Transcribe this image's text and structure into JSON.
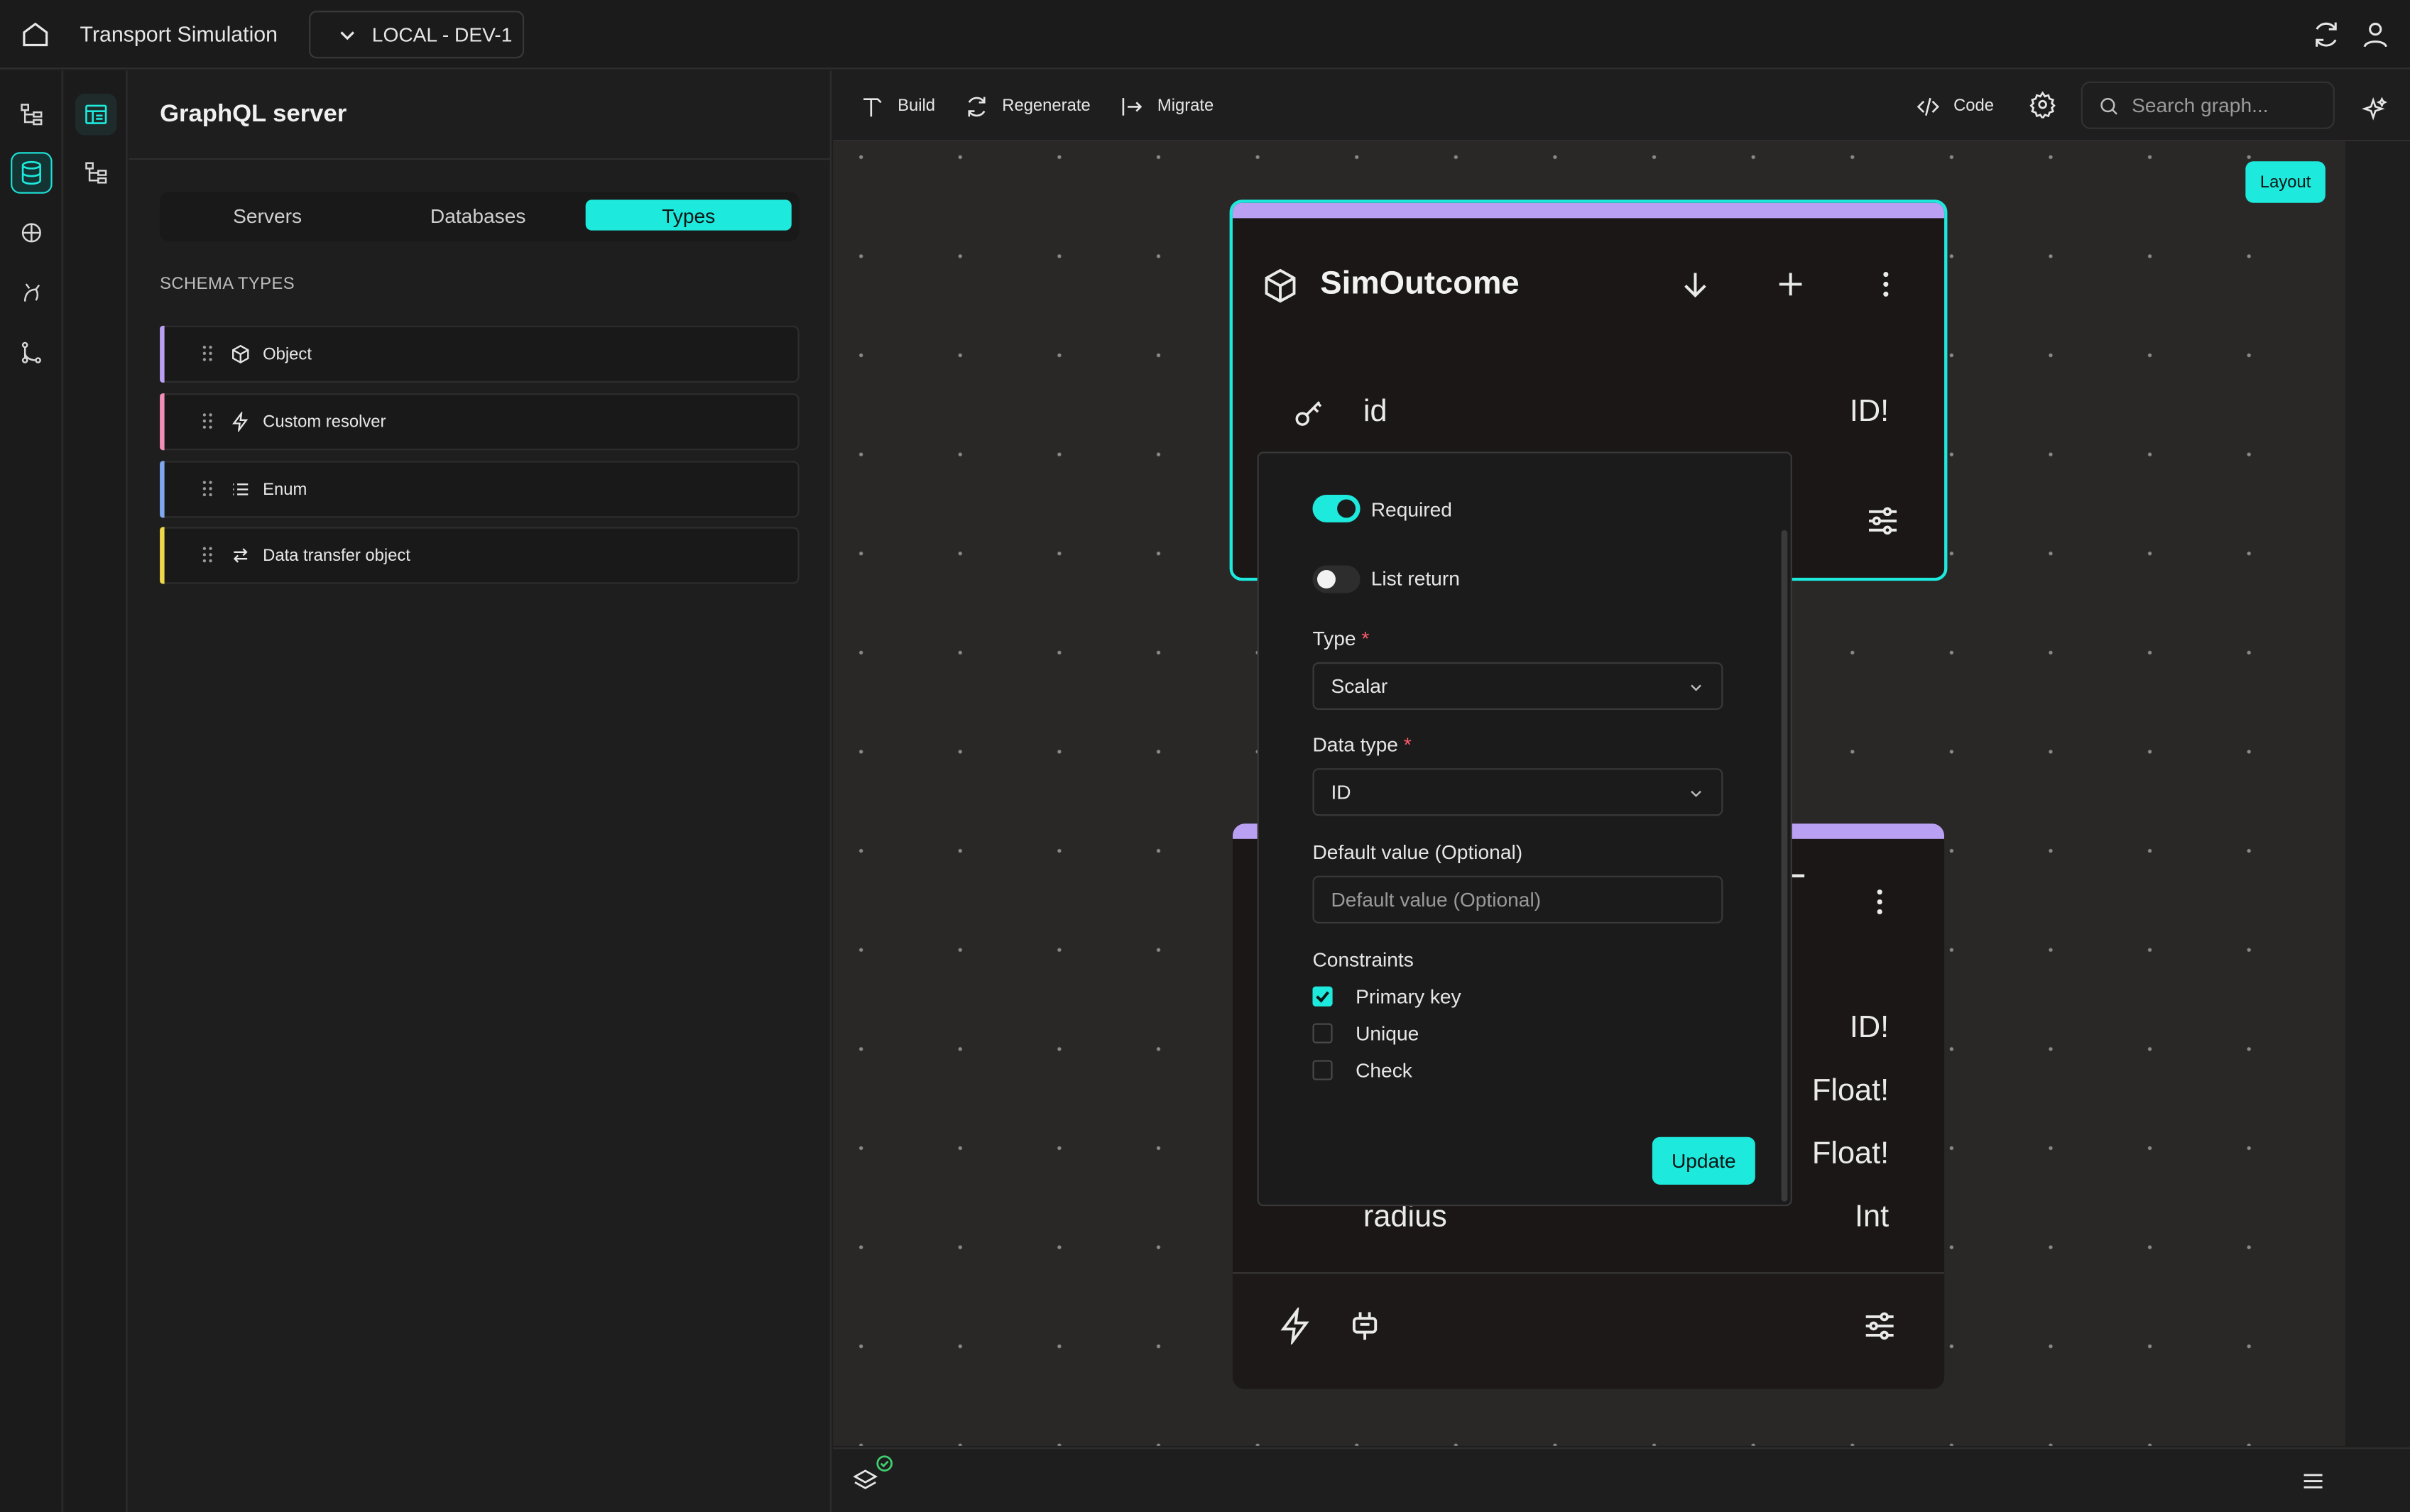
{
  "app": {
    "title": "Transport Simulation",
    "environment": "LOCAL - DEV-1"
  },
  "panel": {
    "title": "GraphQL server",
    "tabs": [
      {
        "label": "Servers"
      },
      {
        "label": "Databases"
      },
      {
        "label": "Types",
        "active": true
      }
    ],
    "section_label": "SCHEMA TYPES",
    "types": [
      {
        "label": "Object",
        "color": "#b9a0f2",
        "icon": "cube-icon"
      },
      {
        "label": "Custom resolver",
        "color": "#f28fb8",
        "icon": "lightning-icon"
      },
      {
        "label": "Enum",
        "color": "#7fa8f0",
        "icon": "list-icon"
      },
      {
        "label": "Data transfer object",
        "color": "#f0d64a",
        "icon": "transfer-icon"
      }
    ]
  },
  "toolbar": {
    "build": "Build",
    "regenerate": "Regenerate",
    "migrate": "Migrate",
    "code": "Code",
    "search_placeholder": "Search graph..."
  },
  "canvas": {
    "layout_button": "Layout",
    "node_main": {
      "title": "SimOutcome",
      "field": {
        "name": "id",
        "type": "ID!"
      }
    },
    "node_second": {
      "field_types": [
        "ID!",
        "Float!",
        "Float!",
        "Int"
      ],
      "last_field_name": "radius"
    }
  },
  "field_editor": {
    "required_label": "Required",
    "required_on": true,
    "list_return_label": "List return",
    "list_return_on": false,
    "type_label": "Type",
    "type_value": "Scalar",
    "data_type_label": "Data type",
    "data_type_value": "ID",
    "default_label": "Default value (Optional)",
    "default_placeholder": "Default value (Optional)",
    "constraints_label": "Constraints",
    "constraints": [
      {
        "label": "Primary key",
        "checked": true
      },
      {
        "label": "Unique",
        "checked": false
      },
      {
        "label": "Check",
        "checked": false
      }
    ],
    "update_button": "Update"
  },
  "colors": {
    "accent": "#1de9dc",
    "object_header": "#b9a0f2",
    "canvas_bg": "#292827"
  }
}
